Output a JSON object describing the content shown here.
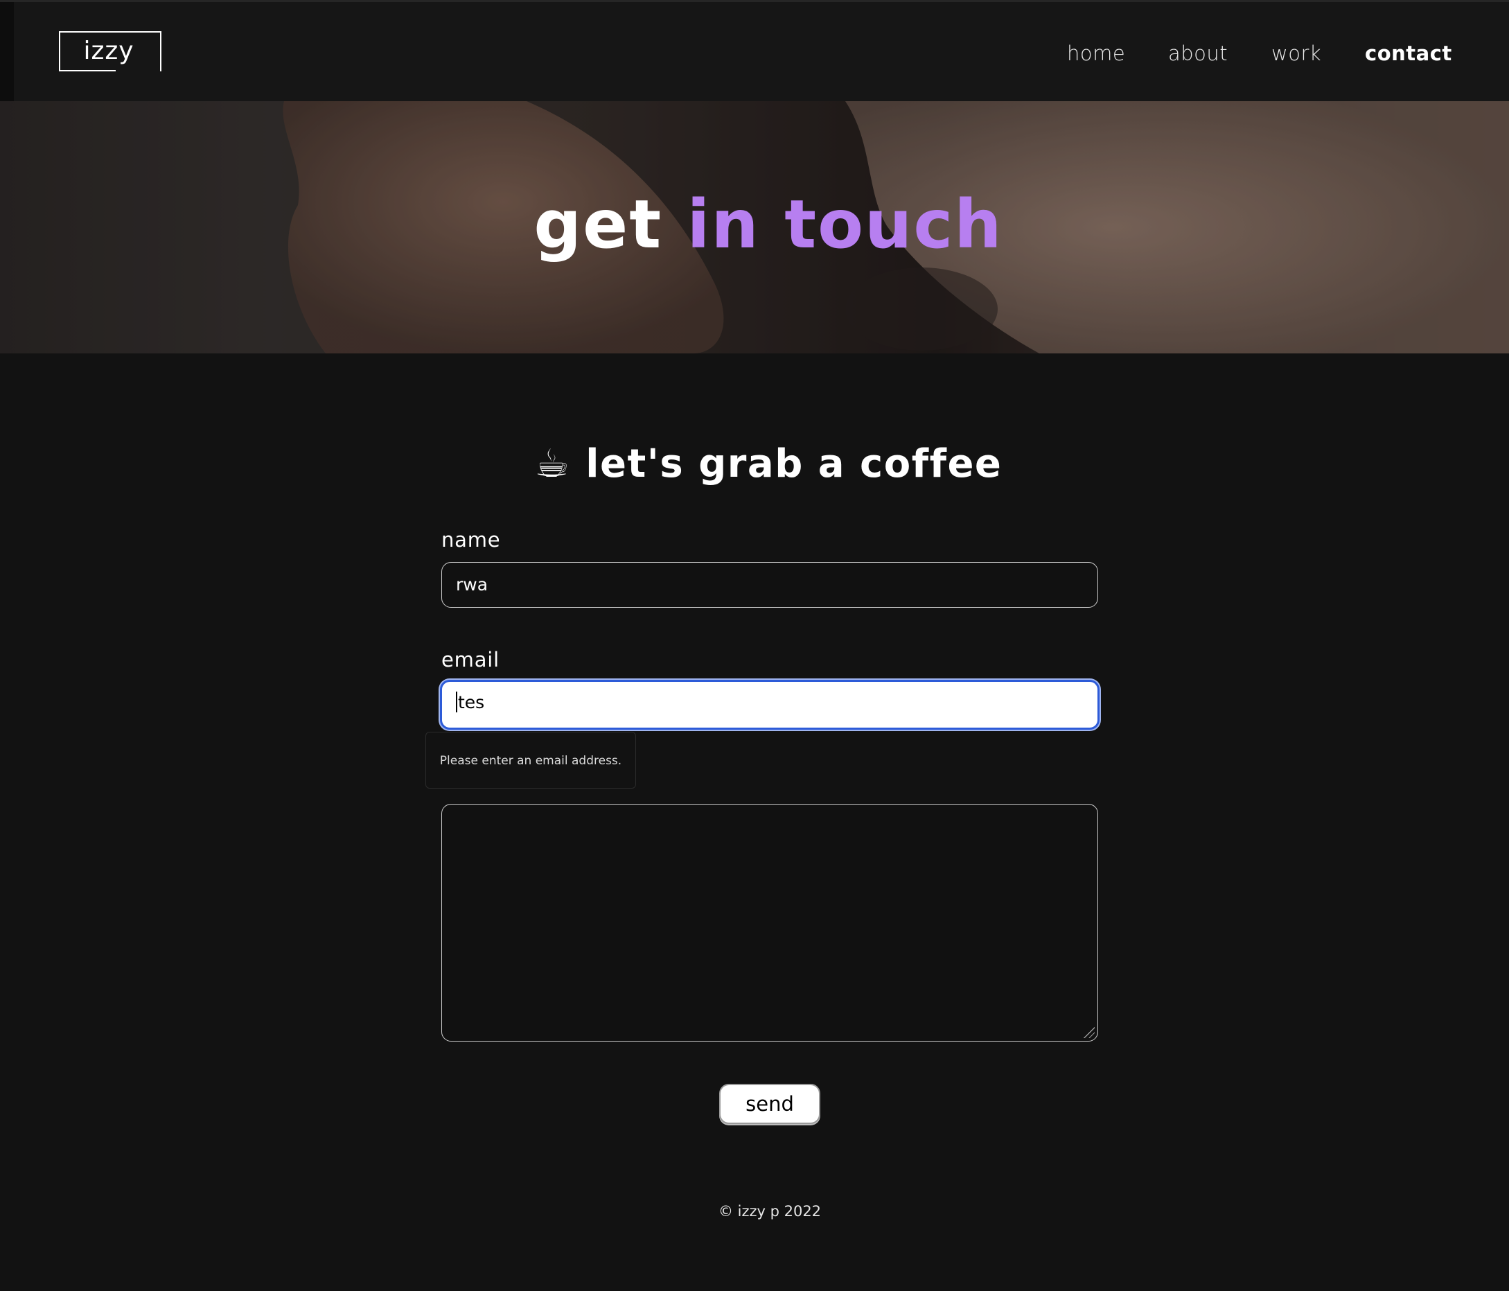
{
  "header": {
    "logo": "izzy",
    "nav": [
      {
        "label": "home",
        "active": false
      },
      {
        "label": "about",
        "active": false
      },
      {
        "label": "work",
        "active": false
      },
      {
        "label": "contact",
        "active": true
      }
    ]
  },
  "hero": {
    "title_white": "get",
    "title_accent": "in touch",
    "accent_color": "#b77ff0"
  },
  "section": {
    "emoji": "☕",
    "title": "let's grab a coffee"
  },
  "form": {
    "name_label": "name",
    "name_value": "rwa",
    "email_label": "email",
    "email_value": "tes",
    "validation_message": "Please enter an email address.",
    "message_value": "",
    "send_label": "send"
  },
  "footer": {
    "copyright": "© izzy p 2022"
  }
}
